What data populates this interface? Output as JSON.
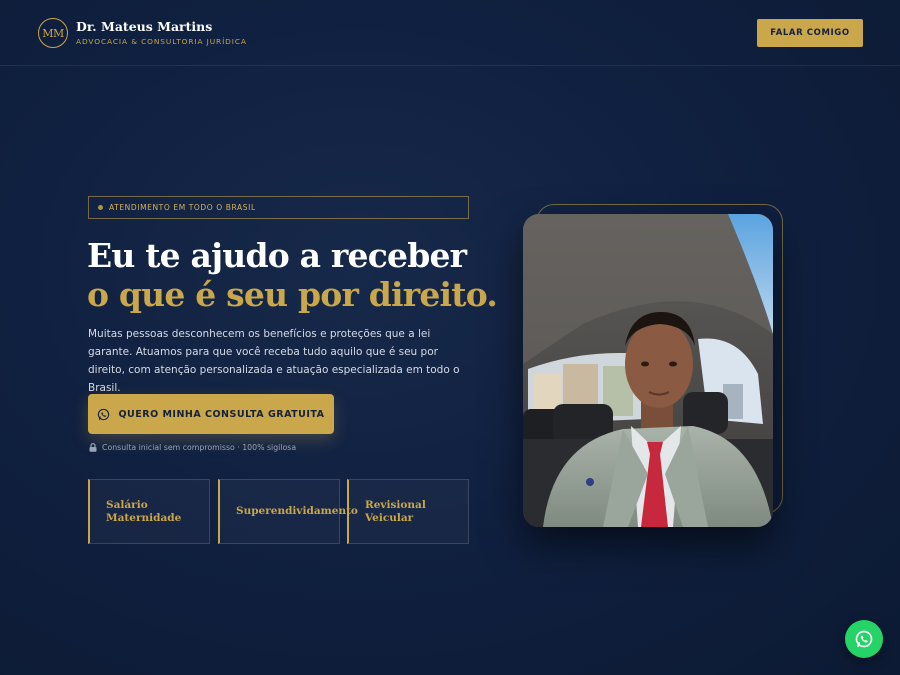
{
  "header": {
    "logo_initials": "MM",
    "name": "Dr. Mateus Martins",
    "subtitle": "ADVOCACIA & CONSULTORIA JURÍDICA",
    "cta_label": "FALAR COMIGO"
  },
  "hero": {
    "badge": "ATENDIMENTO EM TODO O BRASIL",
    "headline_line1": "Eu te ajudo a receber",
    "headline_line2": "o que é seu por direito.",
    "description": "Muitas pessoas desconhecem os benefícios e proteções que a lei garante. Atuamos para que você receba tudo aquilo que é seu por direito, com atenção personalizada e atuação especializada em todo o Brasil.",
    "cta_label": "QUERO MINHA CONSULTA GRATUITA",
    "note": "Consulta inicial sem compromisso · 100% sigilosa"
  },
  "services": [
    {
      "label": "Salário Maternidade"
    },
    {
      "label": "Superendividamento"
    },
    {
      "label": "Revisional Veicular"
    }
  ],
  "icons": {
    "whatsapp": "whatsapp-icon",
    "lock": "lock-icon"
  },
  "colors": {
    "background": "#102040",
    "accent_gold": "#c9a74a",
    "whatsapp_green": "#25d366"
  }
}
